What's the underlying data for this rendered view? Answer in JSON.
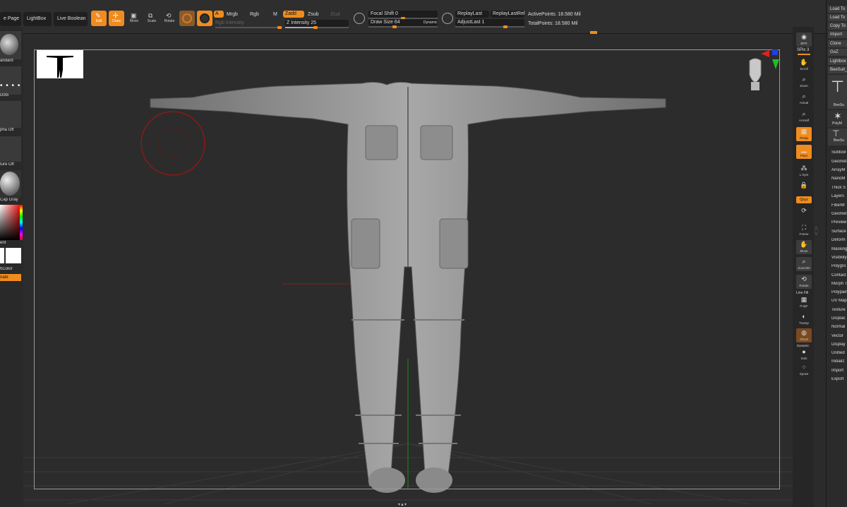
{
  "topbar": {
    "home_page": "e Page",
    "lightbox": "LightBox",
    "live_boolean": "Live Boolean",
    "tools": {
      "edit": "Edit",
      "draw": "Draw",
      "move": "Move",
      "scale": "Scale",
      "rotate": "Rotate"
    },
    "a_label": "A",
    "mrgb": "Mrgb",
    "rgb": "Rgb",
    "m": "M",
    "rgb_intensity": "Rgb Intensity",
    "zadd": "Zadd",
    "zsub": "Zsub",
    "zcut": "Zcut",
    "z_intensity": "Z Intensity 25",
    "focal_shift": "Focal Shift 0",
    "draw_size": "Draw Size 64",
    "dynamic": "Dynamic",
    "replay_last": "ReplayLast",
    "replay_last_rel": "ReplayLastRel",
    "adjust_last": "AdjustLast 1",
    "active_points": "ActivePoints: 18.580 Mil",
    "total_points": "TotalPoints: 18.580 Mil",
    "colors": {
      "accent": "#f08c1e",
      "bg": "#2e2e2e"
    }
  },
  "leftpanel": {
    "brush": "andard",
    "stroke": "Dots",
    "alpha": "pha Off",
    "texture": "ture Off",
    "material": "Cap Gray",
    "gradient": "ent",
    "switch_color": "hColor",
    "alternate": "nate"
  },
  "shelf": {
    "bpr": "BPR",
    "spix": "SPix 3",
    "scroll": "Scroll",
    "zoom": "Zoom",
    "actual": "Actual",
    "aahalf": "AAHalf",
    "persp": "Persp",
    "floor": "Floor",
    "lsym": "L.Sym",
    "local": "",
    "xyz": "Qxyz",
    "frame": "Frame",
    "move": "Move",
    "zoom3d": "Zoom3D",
    "rotate": "Rotate",
    "line_fill": "Line Fill",
    "polyf": "PolyF",
    "transp": "Transp",
    "ghost": "Ghost",
    "dynamic": "Dynamic",
    "solo": "Solo",
    "xpose": "Xpose"
  },
  "rightpanel": {
    "buttons": [
      "Load To",
      "Load To",
      "Copy To",
      "Import",
      "Clone",
      "GoZ",
      "Lightbox",
      "BeeSuit_"
    ],
    "thumb1": "BeeSu",
    "thumb2": "PolyM",
    "thumb3": "BeeSu",
    "menu": [
      "Subtool",
      "Geomet",
      "ArrayM",
      "NanoM",
      "Thick S",
      "Layers",
      "FiberM",
      "Geomet",
      "Preview",
      "Surface",
      "Deform",
      "Masking",
      "Visibility",
      "Polygro",
      "Contact",
      "Morph T",
      "Polypain",
      "UV Map",
      "Texture",
      "Displac",
      "Normal",
      "Vector",
      "Display",
      "Unified",
      "Initializ",
      "Import",
      "Export"
    ]
  }
}
